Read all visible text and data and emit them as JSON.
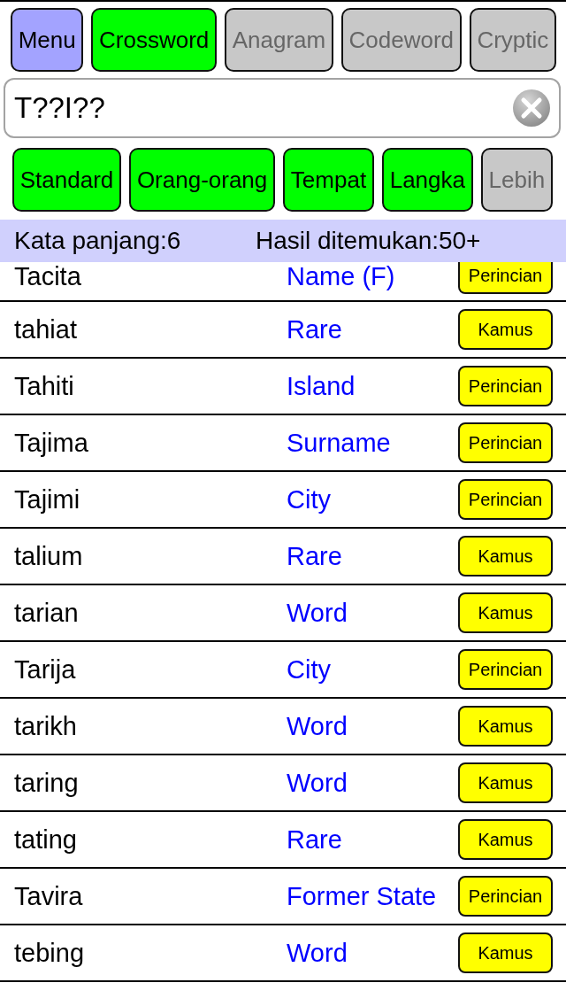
{
  "menu_button": {
    "label": "Menu"
  },
  "mode_tabs": [
    {
      "label": "Crossword",
      "selected": true
    },
    {
      "label": "Anagram",
      "selected": false
    },
    {
      "label": "Codeword",
      "selected": false
    },
    {
      "label": "Cryptic",
      "selected": false
    }
  ],
  "search": {
    "value": "T??I??"
  },
  "filters": [
    {
      "label": "Standard",
      "on": true
    },
    {
      "label": "Orang-orang",
      "on": true
    },
    {
      "label": "Tempat",
      "on": true
    },
    {
      "label": "Langka",
      "on": true
    },
    {
      "label": "Lebih",
      "on": false
    }
  ],
  "info_bar": {
    "word_length": "Kata panjang:6",
    "results_found": "Hasil ditemukan:50+"
  },
  "results": [
    {
      "word": "Tacita",
      "category": "Name (F)",
      "action": "Perincian"
    },
    {
      "word": "tahiat",
      "category": "Rare",
      "action": "Kamus"
    },
    {
      "word": "Tahiti",
      "category": "Island",
      "action": "Perincian"
    },
    {
      "word": "Tajima",
      "category": "Surname",
      "action": "Perincian"
    },
    {
      "word": "Tajimi",
      "category": "City",
      "action": "Perincian"
    },
    {
      "word": "talium",
      "category": "Rare",
      "action": "Kamus"
    },
    {
      "word": "tarian",
      "category": "Word",
      "action": "Kamus"
    },
    {
      "word": "Tarija",
      "category": "City",
      "action": "Perincian"
    },
    {
      "word": "tarikh",
      "category": "Word",
      "action": "Kamus"
    },
    {
      "word": "taring",
      "category": "Word",
      "action": "Kamus"
    },
    {
      "word": "tating",
      "category": "Rare",
      "action": "Kamus"
    },
    {
      "word": "Tavira",
      "category": "Former State",
      "action": "Perincian"
    },
    {
      "word": "tebing",
      "category": "Word",
      "action": "Kamus"
    }
  ]
}
